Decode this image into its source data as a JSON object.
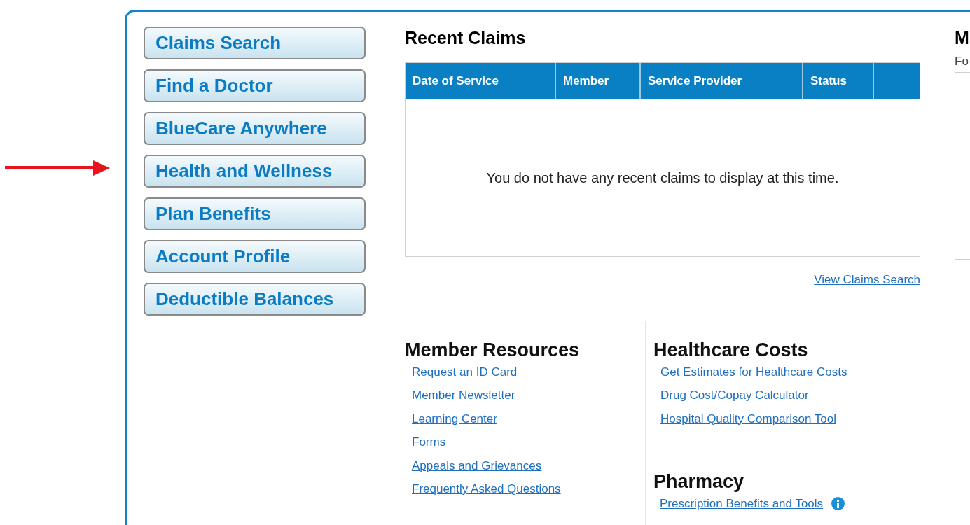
{
  "annotation": {
    "kind": "arrow"
  },
  "nav_buttons": [
    "Claims Search",
    "Find a Doctor",
    "BlueCare Anywhere",
    "Health and Wellness",
    "Plan Benefits",
    "Account Profile",
    "Deductible Balances"
  ],
  "recent_claims": {
    "title": "Recent Claims",
    "columns": [
      "Date of Service",
      "Member",
      "Service Provider",
      "Status"
    ],
    "empty_message": "You do not have any recent claims to display at this time.",
    "link": "View Claims Search"
  },
  "member_resources": {
    "title": "Member Resources",
    "links": [
      "Request an ID Card",
      "Member Newsletter",
      "Learning Center",
      "Forms",
      "Appeals and Grievances",
      "Frequently Asked Questions"
    ]
  },
  "healthcare_costs": {
    "title": "Healthcare Costs",
    "links": [
      "Get Estimates for Healthcare Costs",
      "Drug Cost/Copay Calculator",
      "Hospital Quality Comparison Tool"
    ]
  },
  "pharmacy": {
    "title": "Pharmacy",
    "links": [
      {
        "label": "Prescription Benefits and Tools",
        "info": true
      }
    ]
  },
  "right_panel": {
    "title": "M",
    "subtitle": "Fo"
  }
}
